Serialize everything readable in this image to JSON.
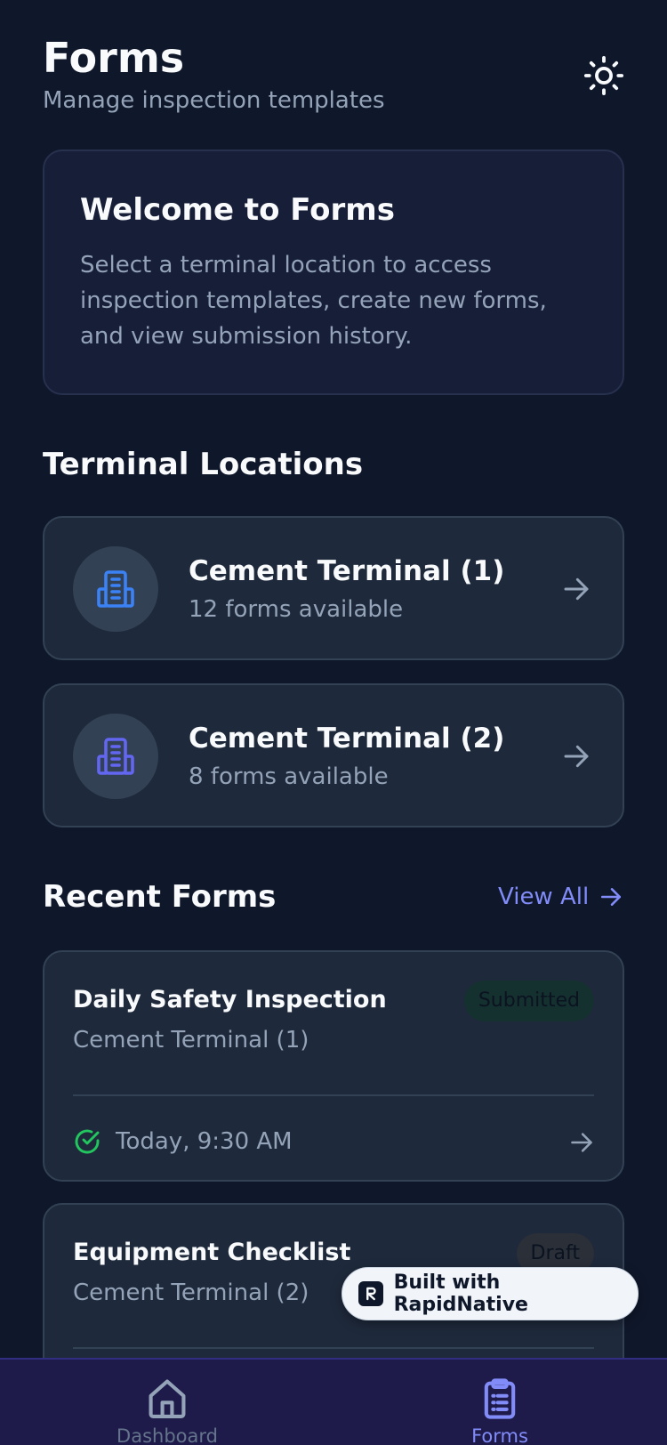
{
  "header": {
    "title": "Forms",
    "subtitle": "Manage inspection templates",
    "theme_icon": "sun-icon"
  },
  "welcome": {
    "title": "Welcome to Forms",
    "text": "Select a terminal location to access inspection templates, create new forms, and view submission history."
  },
  "terminals": {
    "section_title": "Terminal Locations",
    "items": [
      {
        "name": "Cement Terminal (1)",
        "count": "12 forms available",
        "icon": "building-icon",
        "icon_color": "#3b82f6"
      },
      {
        "name": "Cement Terminal (2)",
        "count": "8 forms available",
        "icon": "building-icon",
        "icon_color": "#6366f1"
      }
    ]
  },
  "recent": {
    "section_title": "Recent Forms",
    "view_all": "View All",
    "items": [
      {
        "title": "Daily Safety Inspection",
        "terminal": "Cement Terminal (1)",
        "status": "Submitted",
        "time": "Today, 9:30 AM"
      },
      {
        "title": "Equipment Checklist",
        "terminal": "Cement Terminal (2)",
        "status": "Draft",
        "time": ""
      }
    ]
  },
  "built_badge": {
    "text": "Built with RapidNative"
  },
  "tabs": [
    {
      "label": "Dashboard",
      "icon": "home-icon",
      "active": false
    },
    {
      "label": "Forms",
      "icon": "clipboard-icon",
      "active": true
    }
  ],
  "colors": {
    "background": "#0f172a",
    "card": "#1e293b",
    "accent": "#818cf8",
    "success": "#22c55e"
  }
}
